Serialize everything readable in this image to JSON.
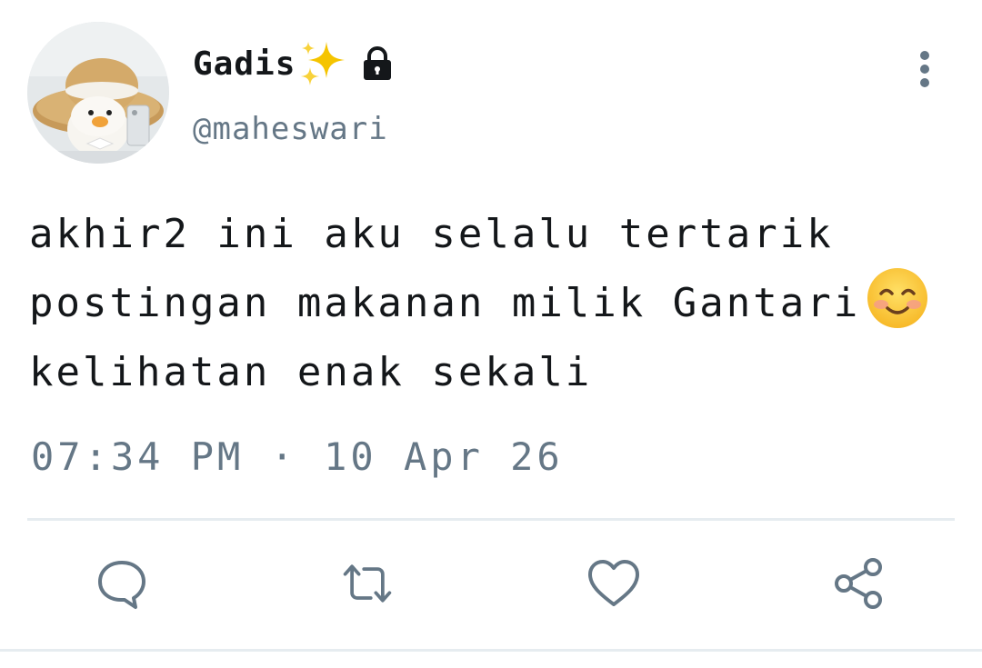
{
  "tweet": {
    "author": {
      "display_name": "Gadis",
      "handle": "@maheswari",
      "badges": [
        "sparkles-icon",
        "lock-icon"
      ]
    },
    "text_lines": [
      "akhir2 ini aku selalu tertarik",
      "postingan makanan milik Gantari",
      "kelihatan enak sekali"
    ],
    "text_emoji": "smiling-face-icon",
    "timestamp": "07:34 PM · 10 Apr 26"
  },
  "actions": [
    {
      "name": "reply",
      "icon": "comment-icon"
    },
    {
      "name": "retweet",
      "icon": "retweet-icon"
    },
    {
      "name": "like",
      "icon": "heart-icon"
    },
    {
      "name": "share",
      "icon": "share-icon"
    }
  ],
  "menu": {
    "icon": "more-vertical-icon"
  },
  "colors": {
    "text": "#14171a",
    "secondary": "#657786",
    "divider": "#e6ecf0",
    "sparkle": "#f5c400"
  }
}
